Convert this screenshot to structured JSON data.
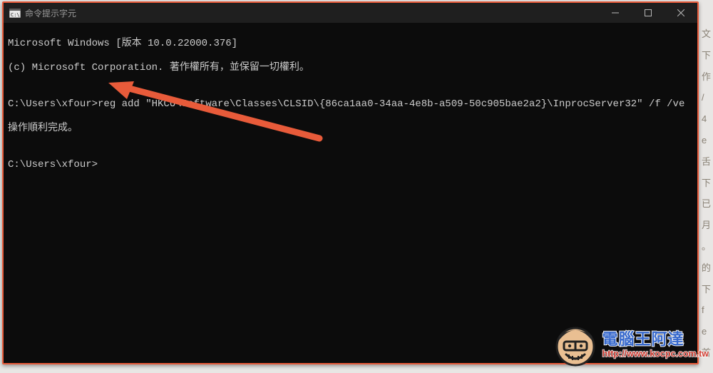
{
  "titlebar": {
    "title": "命令提示字元",
    "minimize": "minimize",
    "maximize": "maximize",
    "close": "close"
  },
  "terminal": {
    "line1": "Microsoft Windows [版本 10.0.22000.376]",
    "line2": "(c) Microsoft Corporation. 著作權所有，並保留一切權利。",
    "blank1": "",
    "line3": "C:\\Users\\xfour>reg add \"HKCU\\Software\\Classes\\CLSID\\{86ca1aa0-34aa-4e8b-a509-50c905bae2a2}\\InprocServer32\" /f /ve",
    "line4": "操作順利完成。",
    "blank2": "",
    "line5": "C:\\Users\\xfour>"
  },
  "watermark": {
    "title": "電腦王阿達",
    "url": "http://www.kocpc.com.tw"
  }
}
